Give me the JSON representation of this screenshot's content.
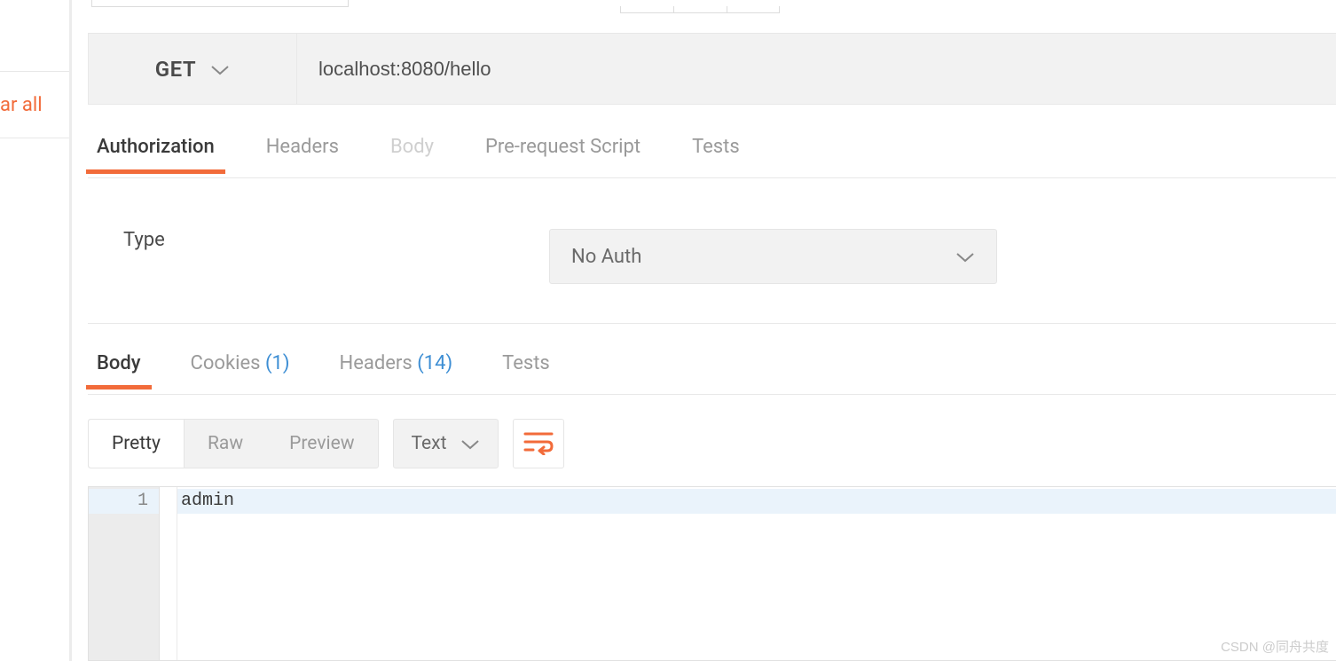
{
  "sidebar": {
    "clear_all_partial": "ar all"
  },
  "request": {
    "method": "GET",
    "url": "localhost:8080/hello",
    "tabs": {
      "authorization": "Authorization",
      "headers": "Headers",
      "body": "Body",
      "prerequest": "Pre-request Script",
      "tests": "Tests"
    }
  },
  "auth": {
    "type_label": "Type",
    "selected": "No Auth"
  },
  "response": {
    "tabs": {
      "body": "Body",
      "cookies": "Cookies",
      "cookies_count": "(1)",
      "headers": "Headers",
      "headers_count": "(14)",
      "tests": "Tests"
    },
    "view": {
      "pretty": "Pretty",
      "raw": "Raw",
      "preview": "Preview"
    },
    "format": "Text",
    "lines": {
      "1": {
        "num": "1",
        "content": "admin"
      }
    }
  },
  "watermark": "CSDN @同舟共度"
}
